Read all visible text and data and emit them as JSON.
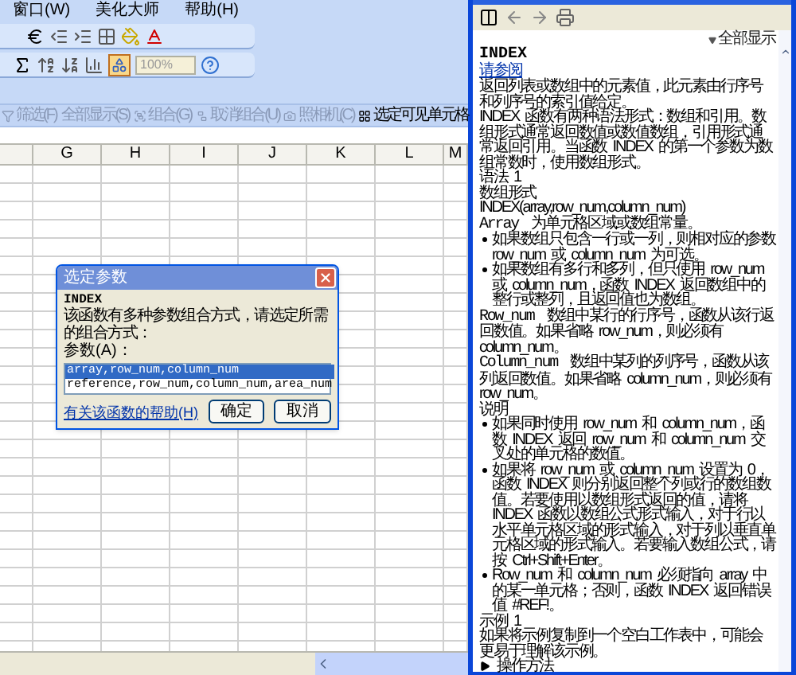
{
  "menu_bar": [
    "窗口(W)",
    "美化大师",
    "帮助(H)"
  ],
  "toolbar": {
    "zoom": "100%"
  },
  "filter_toolbar": [
    "筛选(F)",
    "全部显示(S)",
    "组合(G)",
    "取消组合(U)",
    "照相机(C)",
    "选定可见单元格"
  ],
  "sheet": {
    "columns": [
      "G",
      "H",
      "I",
      "J",
      "K",
      "L",
      "M"
    ]
  },
  "dialog": {
    "title": "选定参数",
    "function": "INDEX",
    "prompt": "该函数有多种参数组合方式，请选定所需的组合方式：",
    "list_label": "参数(A)：",
    "options": [
      {
        "text": "array,row_num,column_num",
        "selected": true
      },
      {
        "text": "reference,row_num,column_num,area_num",
        "selected": false
      }
    ],
    "help_link": "有关该函数的帮助(H)",
    "buttons": [
      "确定",
      "取消"
    ]
  },
  "help": {
    "show_all": "全部显示",
    "title": "INDEX",
    "see_also": "请参阅",
    "blocks": [
      {
        "kind": "para",
        "text": "返回列表或数组中的元素值，此元素由行序号和列序号的索引值给定。"
      },
      {
        "kind": "para",
        "text": "INDEX 函数有两种语法形式：数组和引用。数组形式通常返回数值或数值数组，引用形式通常返回引用。当函数 INDEX 的第一个参数为数组常数时，使用数组形式。"
      },
      {
        "kind": "heading",
        "text": "语法 1"
      },
      {
        "kind": "heading",
        "text": "数组形式"
      },
      {
        "kind": "para",
        "text": "INDEX(array,row_num,column_num)"
      },
      {
        "kind": "def",
        "term": "Array",
        "text": "为单元格区域或数组常量。"
      },
      {
        "kind": "bullet",
        "text": "如果数组只包含一行或一列，则相对应的参数 row_num 或 column_num 为可选。"
      },
      {
        "kind": "bullet",
        "text": "如果数组有多行和多列，但只使用 row_num 或 column_num，函数 INDEX 返回数组中的整行或整列，且返回值也为数组。"
      },
      {
        "kind": "def",
        "term": "Row_num",
        "text": "数组中某行的行序号，函数从该行返回数值。如果省略 row_num，则必须有 column_num。"
      },
      {
        "kind": "def",
        "term": "Column_num",
        "text": "数组中某列的列序号，函数从该列返回数值。如果省略 column_num，则必须有 row_num。"
      },
      {
        "kind": "heading",
        "text": "说明"
      },
      {
        "kind": "bullet",
        "text": "如果同时使用 row_num 和 column_num，函数 INDEX 返回 row_num 和 column_num 交叉处的单元格的数值。"
      },
      {
        "kind": "bullet",
        "text": "如果将 row_num 或 column_num 设置为 0，函数 INDEX 则分别返回整个列或行的数组数值。若要使用以数组形式返回的值，请将 INDEX 函数以数组公式形式输入，对于行以水平单元格区域的形式输入，对于列以垂直单元格区域的形式输入。若要输入数组公式，请按 Ctrl+Shift+Enter。"
      },
      {
        "kind": "bullet",
        "text": "Row_num 和 column_num 必须指向 array 中的某一单元格；否则，函数 INDEX 返回错误值 #REF!。"
      },
      {
        "kind": "heading",
        "text": "示例 1"
      },
      {
        "kind": "para",
        "text": "如果将示例复制到一个空白工作表中，可能会更易于理解该示例。"
      },
      {
        "kind": "expander",
        "text": "操作方法"
      }
    ]
  }
}
